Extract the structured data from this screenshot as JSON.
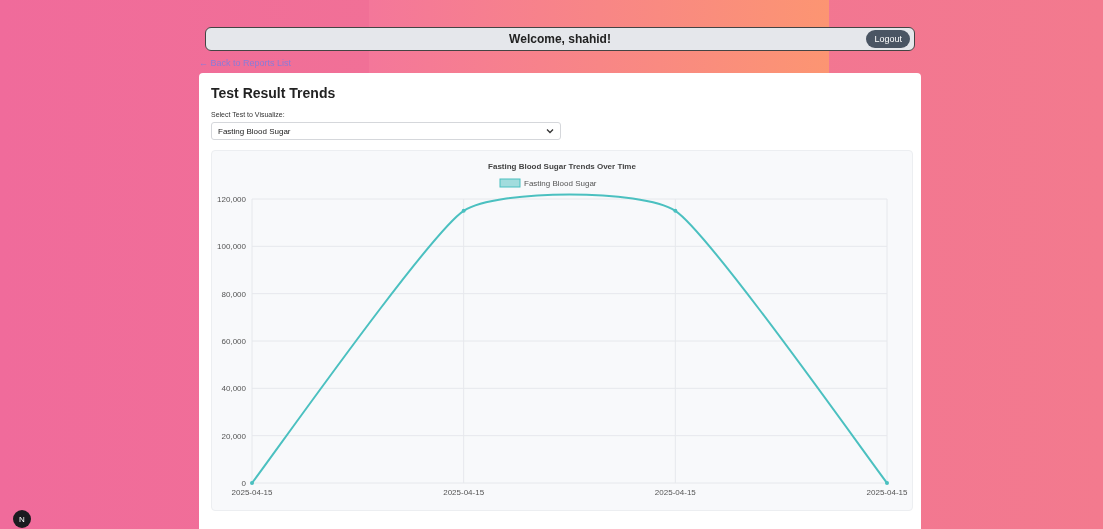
{
  "header": {
    "welcome": "Welcome, shahid!",
    "logout": "Logout"
  },
  "back_link": "← Back to Reports List",
  "card": {
    "title": "Test Result Trends",
    "select_label": "Select Test to Visualize:",
    "select_value": "Fasting Blood Sugar",
    "chart_data": {
      "type": "line",
      "title": "Fasting Blood Sugar Trends Over Time",
      "categories": [
        "2025-04-15",
        "2025-04-15",
        "2025-04-15",
        "2025-04-15"
      ],
      "series": [
        {
          "name": "Fasting Blood Sugar",
          "color": "#4bc0c0",
          "values": [
            0,
            115000,
            115000,
            0
          ]
        }
      ],
      "ylim": [
        0,
        120000
      ],
      "grid": true,
      "yticks": [
        {
          "value": 0,
          "label": "0"
        },
        {
          "value": 20000,
          "label": "20,000"
        },
        {
          "value": 40000,
          "label": "40,000"
        },
        {
          "value": 60000,
          "label": "60,000"
        },
        {
          "value": 80000,
          "label": "80,000"
        },
        {
          "value": 100000,
          "label": "100,000"
        },
        {
          "value": 120000,
          "label": "120,000"
        }
      ]
    }
  },
  "badge": "N"
}
